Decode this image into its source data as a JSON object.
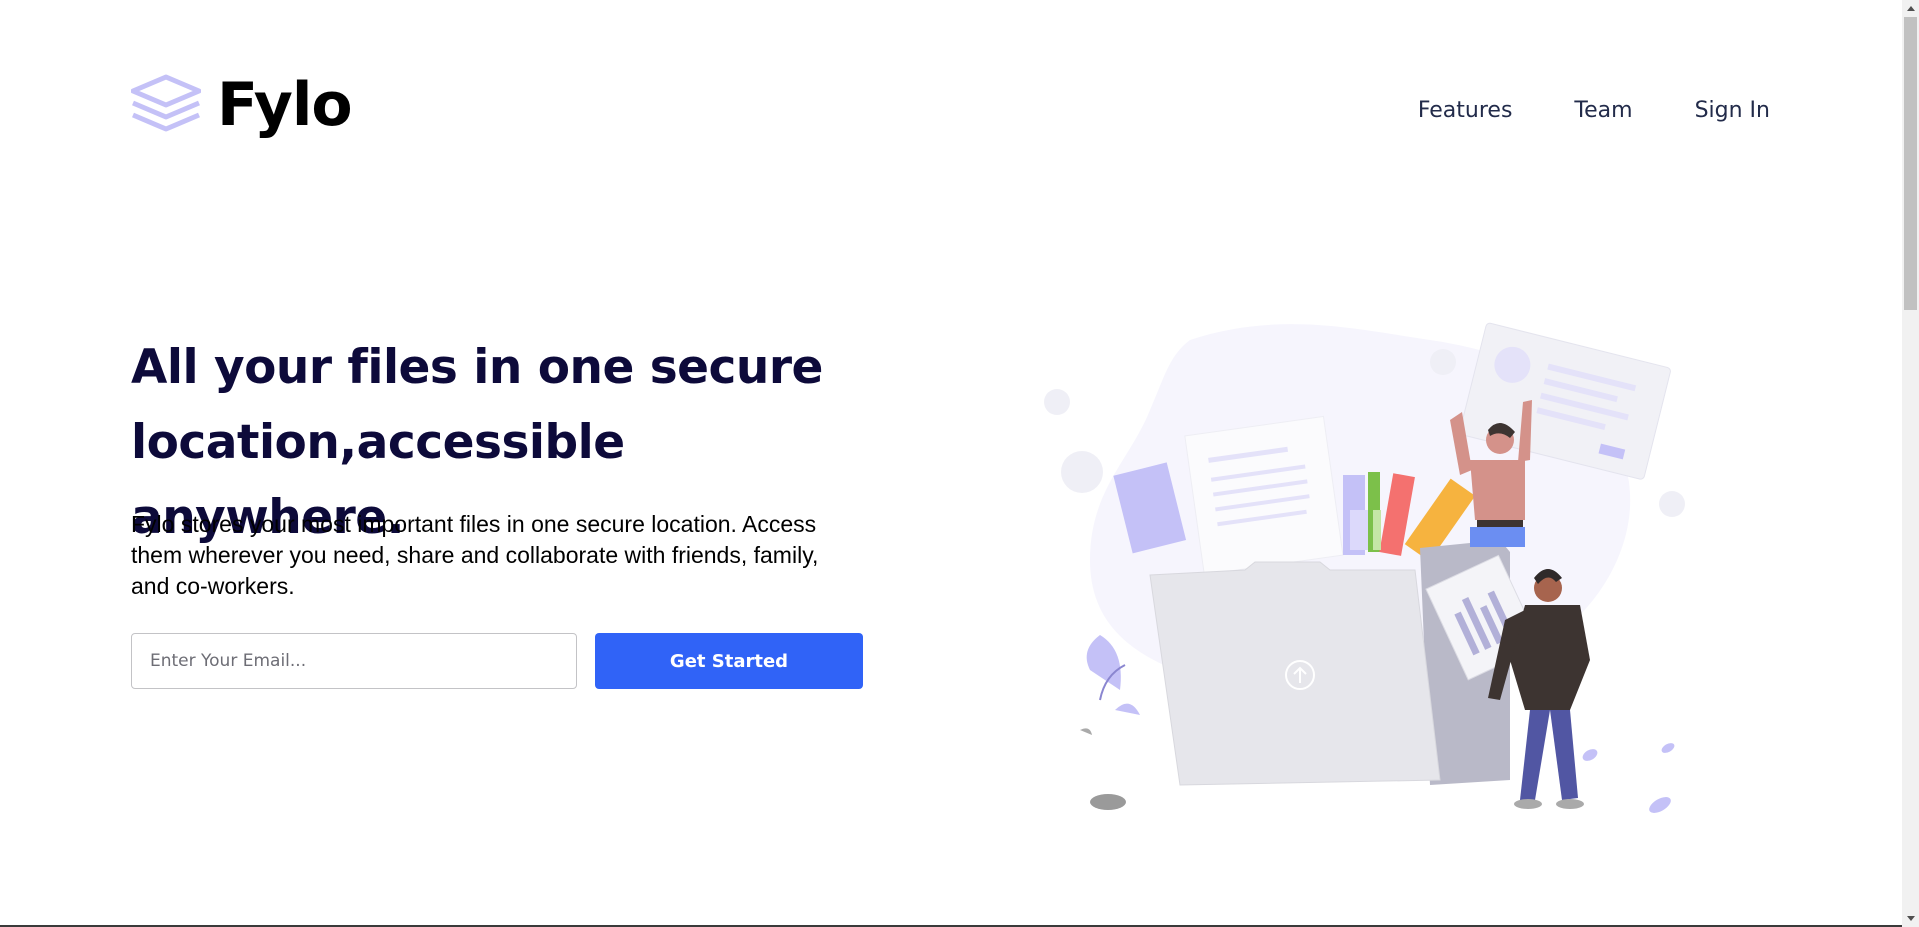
{
  "brand": {
    "name": "Fylo",
    "logo_icon": "layers-icon",
    "logo_color": "#c4c1f7"
  },
  "nav": {
    "items": [
      {
        "label": "Features"
      },
      {
        "label": "Team"
      },
      {
        "label": "Sign In"
      }
    ]
  },
  "hero": {
    "headline_line1": "All your files in one secure",
    "headline_line2": "location,accessible anywhere.",
    "description_line1": "Fylo stores your most important files in one secure location. Access",
    "description_line2": "them wherever you need, share and collaborate with friends, family,",
    "description_line3": "and co-workers.",
    "email_placeholder": "Enter Your Email...",
    "cta_label": "Get Started",
    "illustration_icon": "people-with-folder-illustration"
  },
  "colors": {
    "headline": "#0d0a3a",
    "cta": "#3063f7",
    "nav_text": "#222b4a",
    "accent_lavender": "#c4c1f7"
  }
}
